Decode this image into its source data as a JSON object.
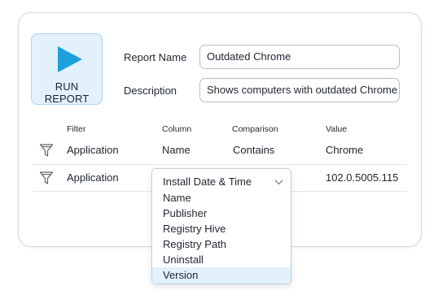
{
  "run_button": {
    "label": "RUN REPORT"
  },
  "report_name": {
    "label": "Report Name",
    "value": "Outdated Chrome"
  },
  "description": {
    "label": "Description",
    "value": "Shows computers with outdated Chrome"
  },
  "filter_table": {
    "headers": {
      "filter": "Filter",
      "column": "Column",
      "comparison": "Comparison",
      "value": "Value"
    },
    "rows": [
      {
        "filter": "Application",
        "column": "Name",
        "comparison": "Contains",
        "value": "Chrome"
      },
      {
        "filter": "Application",
        "column": "Install Date & Time",
        "comparison": "",
        "value": "102.0.5005.115"
      }
    ]
  },
  "column_dropdown": {
    "selected": "Install Date & Time",
    "options": [
      "Name",
      "Publisher",
      "Registry Hive",
      "Registry Path",
      "Uninstall",
      "Version"
    ],
    "highlighted": "Version"
  },
  "colors": {
    "accent": "#1ea0dc",
    "button_bg": "#e2f1fb",
    "border": "#b7bec6"
  },
  "icons": {
    "run": "play-icon",
    "filter": "funnel-icon",
    "dropdown": "chevron-down-icon"
  }
}
